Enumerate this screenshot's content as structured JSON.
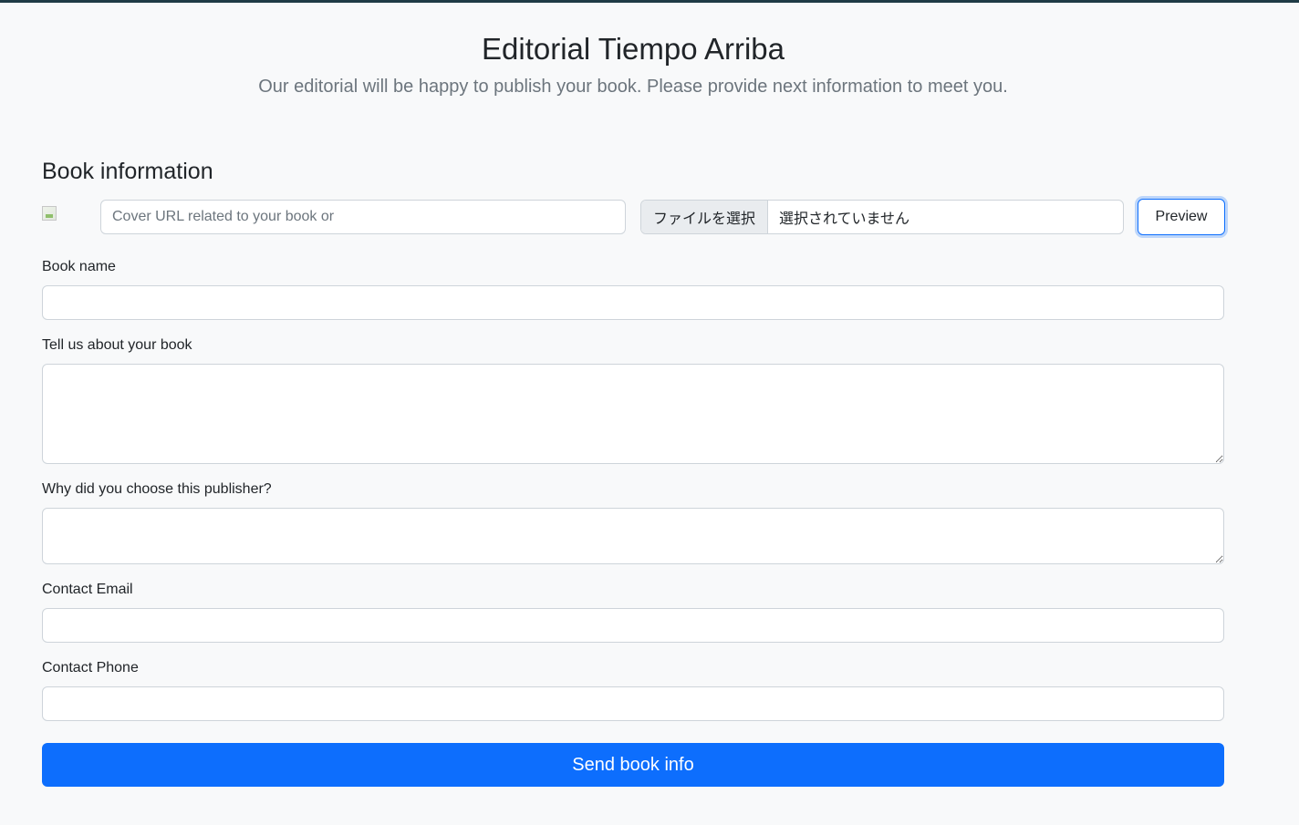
{
  "header": {
    "title": "Editorial Tiempo Arriba",
    "subtitle": "Our editorial will be happy to publish your book. Please provide next information to meet you."
  },
  "form": {
    "section_title": "Book information",
    "cover": {
      "url_placeholder": "Cover URL related to your book or",
      "url_value": "",
      "file_button_label": "ファイルを選択",
      "file_status": "選択されていません",
      "preview_label": "Preview"
    },
    "book_name": {
      "label": "Book name",
      "value": ""
    },
    "about": {
      "label": "Tell us about your book",
      "value": ""
    },
    "why_publisher": {
      "label": "Why did you choose this publisher?",
      "value": ""
    },
    "email": {
      "label": "Contact Email",
      "value": ""
    },
    "phone": {
      "label": "Contact Phone",
      "value": ""
    },
    "submit_label": "Send book info"
  },
  "colors": {
    "primary": "#0d6efd",
    "background": "#f8f9fa",
    "border": "#ced4da",
    "muted_text": "#6c757d"
  },
  "icons": {
    "cover_preview": "broken-image-icon"
  }
}
